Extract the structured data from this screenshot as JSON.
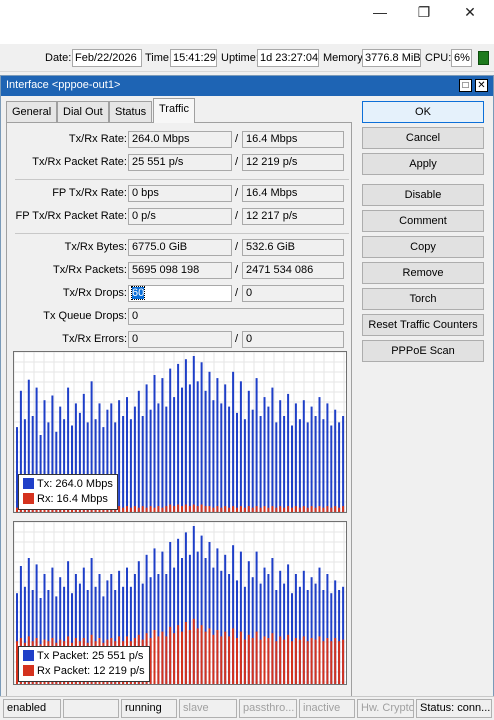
{
  "window": {
    "minimize_icon": "minimize-icon",
    "maximize_icon": "restore-icon",
    "close_icon": "close-icon"
  },
  "status": {
    "date_label": "Date:",
    "date": "Feb/22/2026",
    "time_label": "Time:",
    "time": "15:41:29",
    "uptime_label": "Uptime:",
    "uptime": "1d 23:27:04",
    "memory_label": "Memory:",
    "memory": "3776.8 MiB",
    "cpu_label": "CPU:",
    "cpu": "6%"
  },
  "dialog": {
    "title": "Interface <pppoe-out1>",
    "tabs": [
      "General",
      "Dial Out",
      "Status",
      "Traffic"
    ],
    "active_tab": "Traffic"
  },
  "fields": {
    "txrx_rate": {
      "label": "Tx/Rx Rate:",
      "tx": "264.0 Mbps",
      "rx": "16.4 Mbps"
    },
    "txrx_packet_rate": {
      "label": "Tx/Rx Packet Rate:",
      "tx": "25 551 p/s",
      "rx": "12 219 p/s"
    },
    "fp_txrx_rate": {
      "label": "FP Tx/Rx Rate:",
      "tx": "0 bps",
      "rx": "16.4 Mbps"
    },
    "fp_txrx_packet_rate": {
      "label": "FP Tx/Rx Packet Rate:",
      "tx": "0 p/s",
      "rx": "12 217 p/s"
    },
    "txrx_bytes": {
      "label": "Tx/Rx Bytes:",
      "tx": "6775.0 GiB",
      "rx": "532.6 GiB"
    },
    "txrx_packets": {
      "label": "Tx/Rx Packets:",
      "tx": "5695 098 198",
      "rx": "2471 534 086"
    },
    "txrx_drops": {
      "label": "Tx/Rx Drops:",
      "tx": "60",
      "rx": "0"
    },
    "tx_queue_drops": {
      "label": "Tx Queue Drops:",
      "value": "0"
    },
    "txrx_errors": {
      "label": "Tx/Rx Errors:",
      "tx": "0",
      "rx": "0"
    }
  },
  "graph1": {
    "legend_tx": "Tx:   264.0 Mbps",
    "legend_rx": "Rx:  16.4 Mbps",
    "tx_color": "#1f3fc8",
    "rx_color": "#d4321e"
  },
  "graph2": {
    "legend_tx": "Tx Packet:  25 551 p/s",
    "legend_rx": "Rx Packet:  12 219 p/s",
    "tx_color": "#1f3fc8",
    "rx_color": "#d4321e"
  },
  "chart_data": [
    {
      "type": "bar",
      "title": "",
      "series": [
        {
          "name": "Tx",
          "values": [
            0.55,
            0.78,
            0.6,
            0.85,
            0.62,
            0.8,
            0.5,
            0.72,
            0.58,
            0.75,
            0.52,
            0.68,
            0.6,
            0.8,
            0.56,
            0.7,
            0.64,
            0.76,
            0.58,
            0.84,
            0.6,
            0.7,
            0.55,
            0.66,
            0.7,
            0.58,
            0.72,
            0.62,
            0.74,
            0.6,
            0.68,
            0.78,
            0.62,
            0.82,
            0.66,
            0.88,
            0.7,
            0.86,
            0.68,
            0.92,
            0.74,
            0.95,
            0.8,
            0.98,
            0.82,
            1.0,
            0.84,
            0.96,
            0.78,
            0.9,
            0.72,
            0.86,
            0.7,
            0.82,
            0.68,
            0.9,
            0.64,
            0.84,
            0.6,
            0.78,
            0.66,
            0.86,
            0.62,
            0.74,
            0.68,
            0.8,
            0.58,
            0.72,
            0.62,
            0.76,
            0.56,
            0.7,
            0.6,
            0.72,
            0.58,
            0.68,
            0.62,
            0.74,
            0.6,
            0.7,
            0.56,
            0.66,
            0.58,
            0.62
          ]
        },
        {
          "name": "Rx",
          "values": [
            0.04,
            0.05,
            0.04,
            0.05,
            0.04,
            0.05,
            0.04,
            0.04,
            0.05,
            0.04,
            0.05,
            0.04,
            0.04,
            0.05,
            0.04,
            0.05,
            0.04,
            0.05,
            0.04,
            0.05,
            0.04,
            0.05,
            0.04,
            0.04,
            0.05,
            0.04,
            0.05,
            0.04,
            0.05,
            0.04,
            0.05,
            0.04,
            0.05,
            0.04,
            0.05,
            0.04,
            0.05,
            0.04,
            0.05,
            0.06,
            0.05,
            0.06,
            0.05,
            0.06,
            0.05,
            0.06,
            0.05,
            0.06,
            0.05,
            0.05,
            0.04,
            0.05,
            0.04,
            0.05,
            0.04,
            0.05,
            0.04,
            0.05,
            0.04,
            0.05,
            0.04,
            0.05,
            0.04,
            0.05,
            0.04,
            0.05,
            0.04,
            0.05,
            0.04,
            0.05,
            0.04,
            0.05,
            0.04,
            0.05,
            0.04,
            0.05,
            0.04,
            0.05,
            0.04,
            0.05,
            0.04,
            0.05,
            0.04,
            0.05
          ]
        }
      ]
    },
    {
      "type": "bar",
      "title": "",
      "series": [
        {
          "name": "Tx Packet",
          "values": [
            0.58,
            0.75,
            0.62,
            0.8,
            0.6,
            0.76,
            0.55,
            0.7,
            0.6,
            0.74,
            0.56,
            0.68,
            0.62,
            0.78,
            0.58,
            0.7,
            0.64,
            0.74,
            0.6,
            0.8,
            0.62,
            0.7,
            0.56,
            0.66,
            0.7,
            0.6,
            0.72,
            0.62,
            0.74,
            0.62,
            0.7,
            0.78,
            0.64,
            0.82,
            0.68,
            0.86,
            0.7,
            0.84,
            0.7,
            0.9,
            0.74,
            0.92,
            0.8,
            0.96,
            0.82,
            1.0,
            0.84,
            0.94,
            0.8,
            0.9,
            0.74,
            0.86,
            0.72,
            0.82,
            0.7,
            0.88,
            0.66,
            0.84,
            0.62,
            0.78,
            0.68,
            0.84,
            0.64,
            0.74,
            0.7,
            0.8,
            0.6,
            0.72,
            0.64,
            0.76,
            0.58,
            0.7,
            0.62,
            0.72,
            0.6,
            0.68,
            0.64,
            0.74,
            0.6,
            0.7,
            0.58,
            0.66,
            0.6,
            0.62
          ]
        },
        {
          "name": "Rx Packet",
          "values": [
            0.28,
            0.3,
            0.27,
            0.31,
            0.28,
            0.3,
            0.26,
            0.29,
            0.28,
            0.3,
            0.27,
            0.29,
            0.28,
            0.31,
            0.27,
            0.3,
            0.28,
            0.3,
            0.27,
            0.32,
            0.28,
            0.3,
            0.27,
            0.29,
            0.3,
            0.28,
            0.31,
            0.28,
            0.31,
            0.28,
            0.3,
            0.32,
            0.29,
            0.33,
            0.3,
            0.35,
            0.31,
            0.34,
            0.31,
            0.37,
            0.33,
            0.38,
            0.34,
            0.4,
            0.35,
            0.42,
            0.36,
            0.38,
            0.34,
            0.36,
            0.32,
            0.35,
            0.31,
            0.34,
            0.31,
            0.36,
            0.3,
            0.34,
            0.29,
            0.32,
            0.3,
            0.34,
            0.29,
            0.31,
            0.3,
            0.33,
            0.28,
            0.31,
            0.29,
            0.32,
            0.28,
            0.3,
            0.29,
            0.31,
            0.28,
            0.3,
            0.29,
            0.31,
            0.28,
            0.3,
            0.28,
            0.3,
            0.28,
            0.29
          ]
        }
      ]
    }
  ],
  "actions": [
    "OK",
    "Cancel",
    "Apply",
    "Disable",
    "Comment",
    "Copy",
    "Remove",
    "Torch",
    "Reset Traffic Counters",
    "PPPoE Scan"
  ],
  "bottom": [
    "enabled",
    "",
    "running",
    "slave",
    "passthro...",
    "inactive",
    "Hw. Crypto",
    "Status: conn..."
  ]
}
